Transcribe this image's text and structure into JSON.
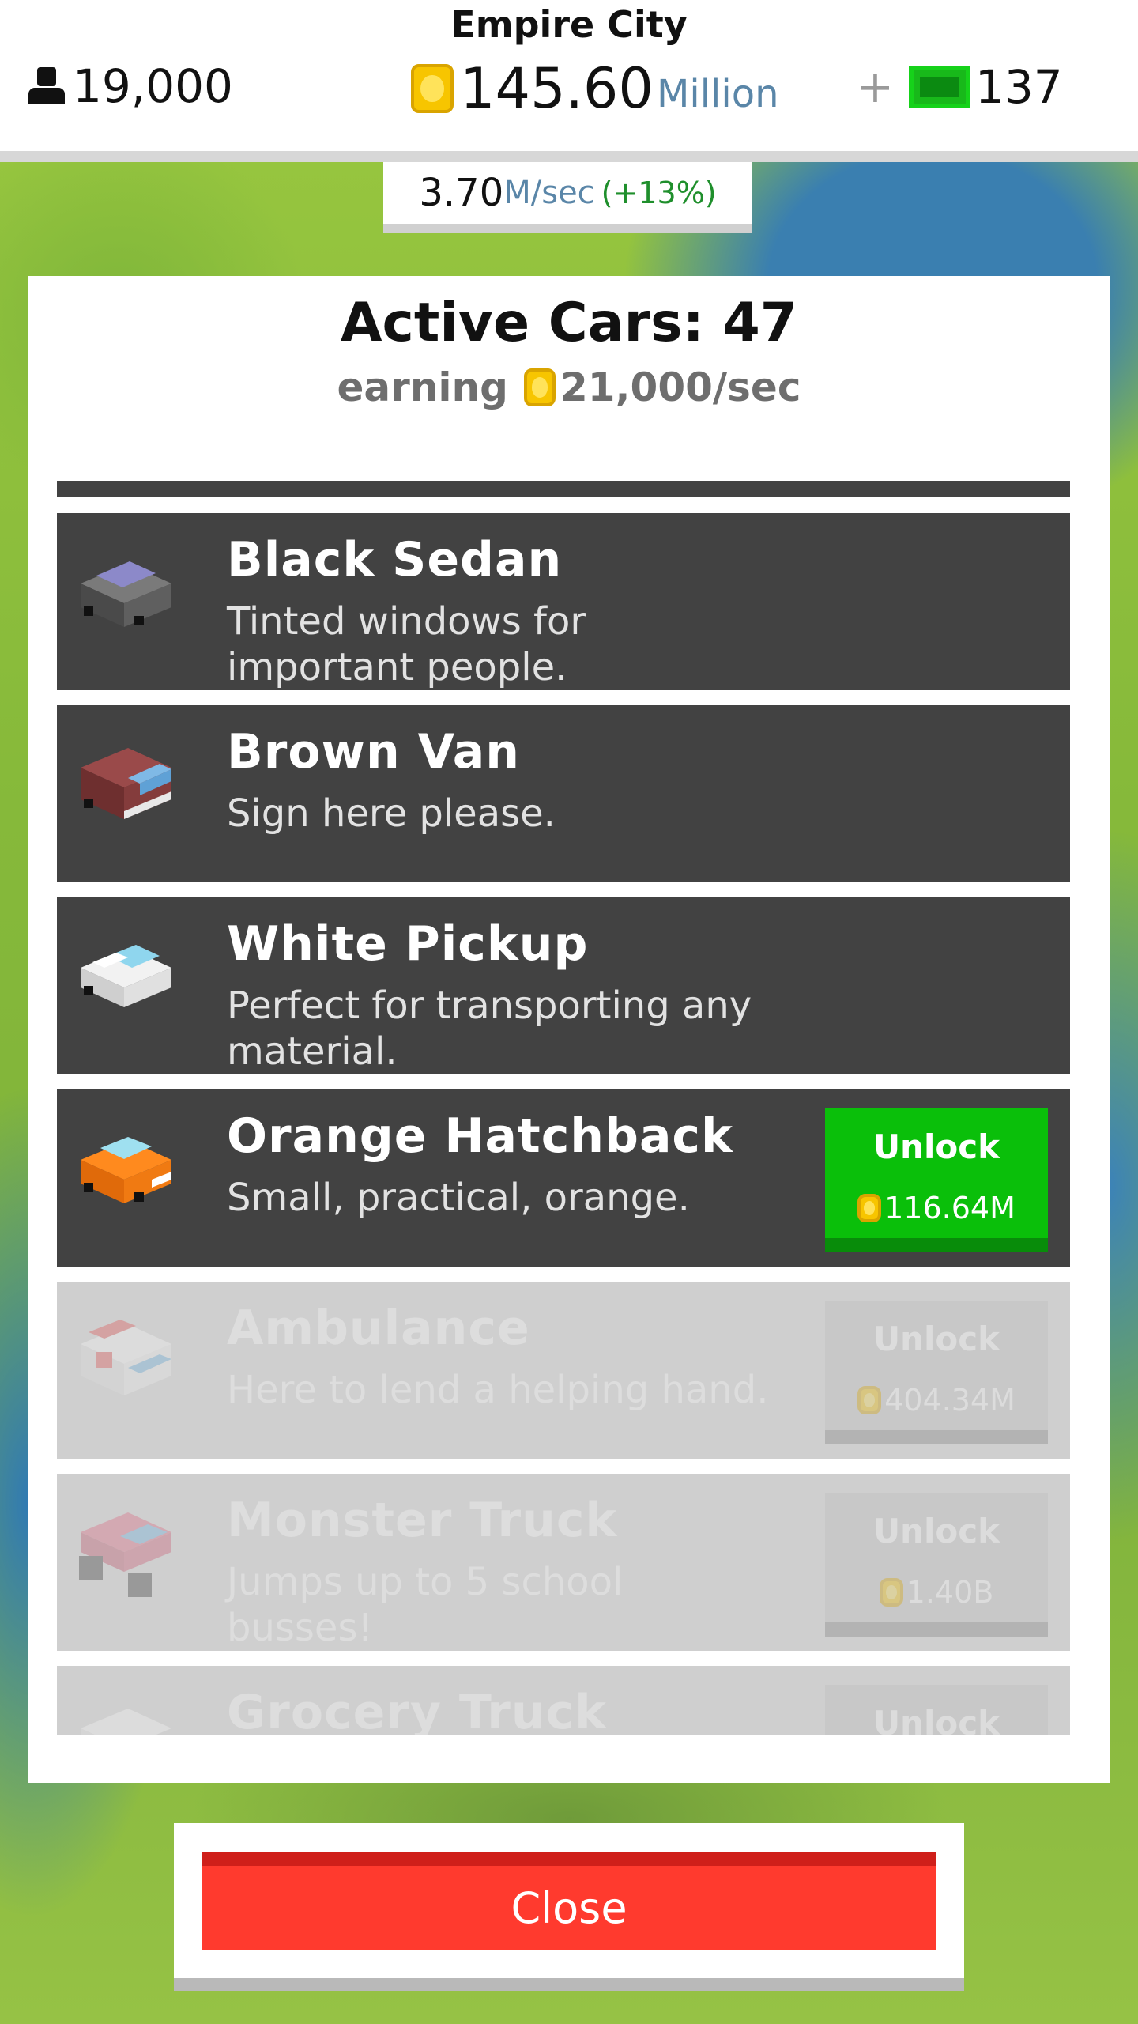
{
  "header": {
    "city_name": "Empire City",
    "population": "19,000",
    "money_amount": "145.60",
    "money_unit": "Million",
    "plus": "+",
    "cash": "137"
  },
  "rate": {
    "value": "3.70",
    "unit": "M/sec",
    "change": "(+13%)"
  },
  "panel": {
    "title": "Active Cars: 47",
    "earning_label": "earning",
    "earning_amount": "21,000/sec",
    "cars": [
      {
        "name": "Black Sedan",
        "description": "Tinted windows for important people.",
        "state": "owned",
        "icon": "black-sedan-icon"
      },
      {
        "name": "Brown Van",
        "description": "Sign here please.",
        "state": "owned",
        "icon": "brown-van-icon"
      },
      {
        "name": "White Pickup",
        "description": "Perfect for transporting any material.",
        "state": "owned",
        "icon": "white-pickup-icon"
      },
      {
        "name": "Orange Hatchback",
        "description": "Small, practical, orange.",
        "state": "available",
        "unlock_label": "Unlock",
        "price": "116.64M",
        "icon": "orange-hatchback-icon"
      },
      {
        "name": "Ambulance",
        "description": "Here to lend a helping hand.",
        "state": "locked",
        "unlock_label": "Unlock",
        "price": "404.34M",
        "icon": "ambulance-icon"
      },
      {
        "name": "Monster Truck",
        "description": "Jumps up to 5 school busses!",
        "state": "locked",
        "unlock_label": "Unlock",
        "price": "1.40B",
        "icon": "monster-truck-icon"
      },
      {
        "name": "Grocery Truck",
        "description": "",
        "state": "locked",
        "unlock_label": "Unlock",
        "price": "",
        "icon": "grocery-truck-icon"
      }
    ]
  },
  "close_label": "Close",
  "colors": {
    "unlock_green": "#0abf0a",
    "close_red": "#ff3a2e",
    "card_dark": "#424242",
    "card_locked": "#cfcfcf",
    "coin_gold": "#f7c500",
    "cash_green": "#18b91a"
  }
}
